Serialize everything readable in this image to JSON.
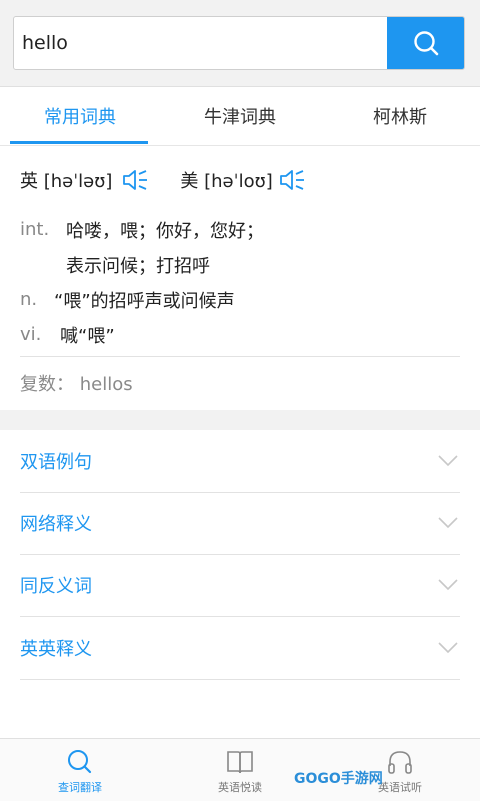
{
  "search": {
    "value": "hello"
  },
  "tabs": [
    {
      "label": "常用词典",
      "active": true
    },
    {
      "label": "牛津词典",
      "active": false
    },
    {
      "label": "柯林斯",
      "active": false
    }
  ],
  "pronunciation": {
    "uk": "英 [həˈləʊ]",
    "us": "美 [həˈloʊ]"
  },
  "definitions": [
    {
      "pos": "int.",
      "meaning": "哈喽，喂；你好，您好；"
    },
    {
      "pos": "",
      "meaning": "表示问候；打招呼"
    },
    {
      "pos": "n.",
      "meaning": "“喂”的招呼声或问候声"
    },
    {
      "pos": "vi.",
      "meaning": "喊“喂”"
    }
  ],
  "plural": "复数： hellos",
  "sections": [
    "双语例句",
    "网络释义",
    "同反义词",
    "英英释义"
  ],
  "bottom_nav": [
    {
      "label": "查词翻译",
      "active": true
    },
    {
      "label": "英语悦读",
      "active": false
    },
    {
      "label": "英语试听",
      "active": false
    }
  ],
  "watermark": "GOGO手游网",
  "colors": {
    "accent": "#1e96f0"
  }
}
